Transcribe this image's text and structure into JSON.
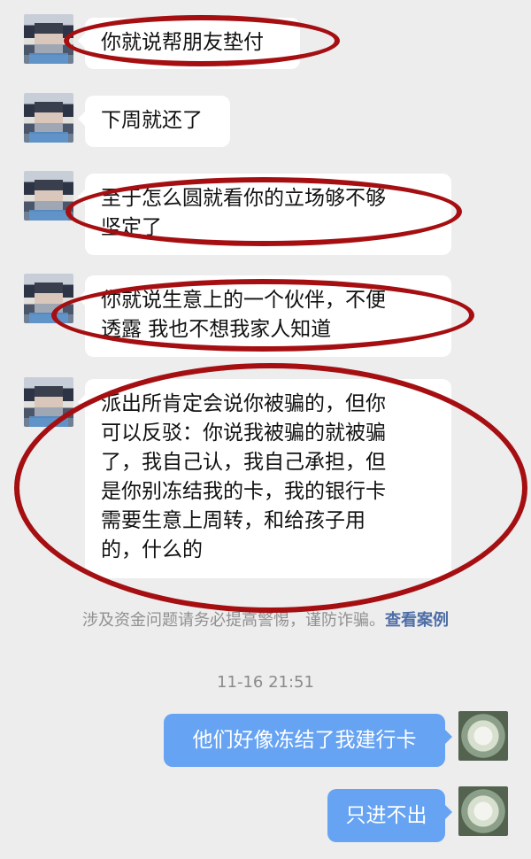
{
  "messages": [
    {
      "text": "你就说帮朋友垫付",
      "direction": "incoming"
    },
    {
      "text": "下周就还了",
      "direction": "incoming"
    },
    {
      "text": "至于怎么圆就看你的立场够不够\n坚定了",
      "direction": "incoming"
    },
    {
      "text": "你就说生意上的一个伙伴，不便\n透露 我也不想我家人知道",
      "direction": "incoming"
    },
    {
      "text": "派出所肯定会说你被骗的，但你\n可以反驳：你说我被骗的就被骗\n了，我自己认，我自己承担，但\n是你别冻结我的卡，我的银行卡\n需要生意上周转，和给孩子用\n的，什么的",
      "direction": "incoming"
    },
    {
      "text": "他们好像冻结了我建行卡",
      "direction": "outgoing"
    },
    {
      "text": "只进不出",
      "direction": "outgoing"
    }
  ],
  "notice": {
    "text": "涉及资金问题请务必提高警惕，谨防诈骗。",
    "link": "查看案例"
  },
  "timestamp": "11-16 21:51",
  "colors": {
    "background": "#ededed",
    "incoming_bubble": "#ffffff",
    "outgoing_bubble": "#66a3f3",
    "highlight_oval": "#a50f12",
    "notice_link": "#4e6ea7"
  }
}
